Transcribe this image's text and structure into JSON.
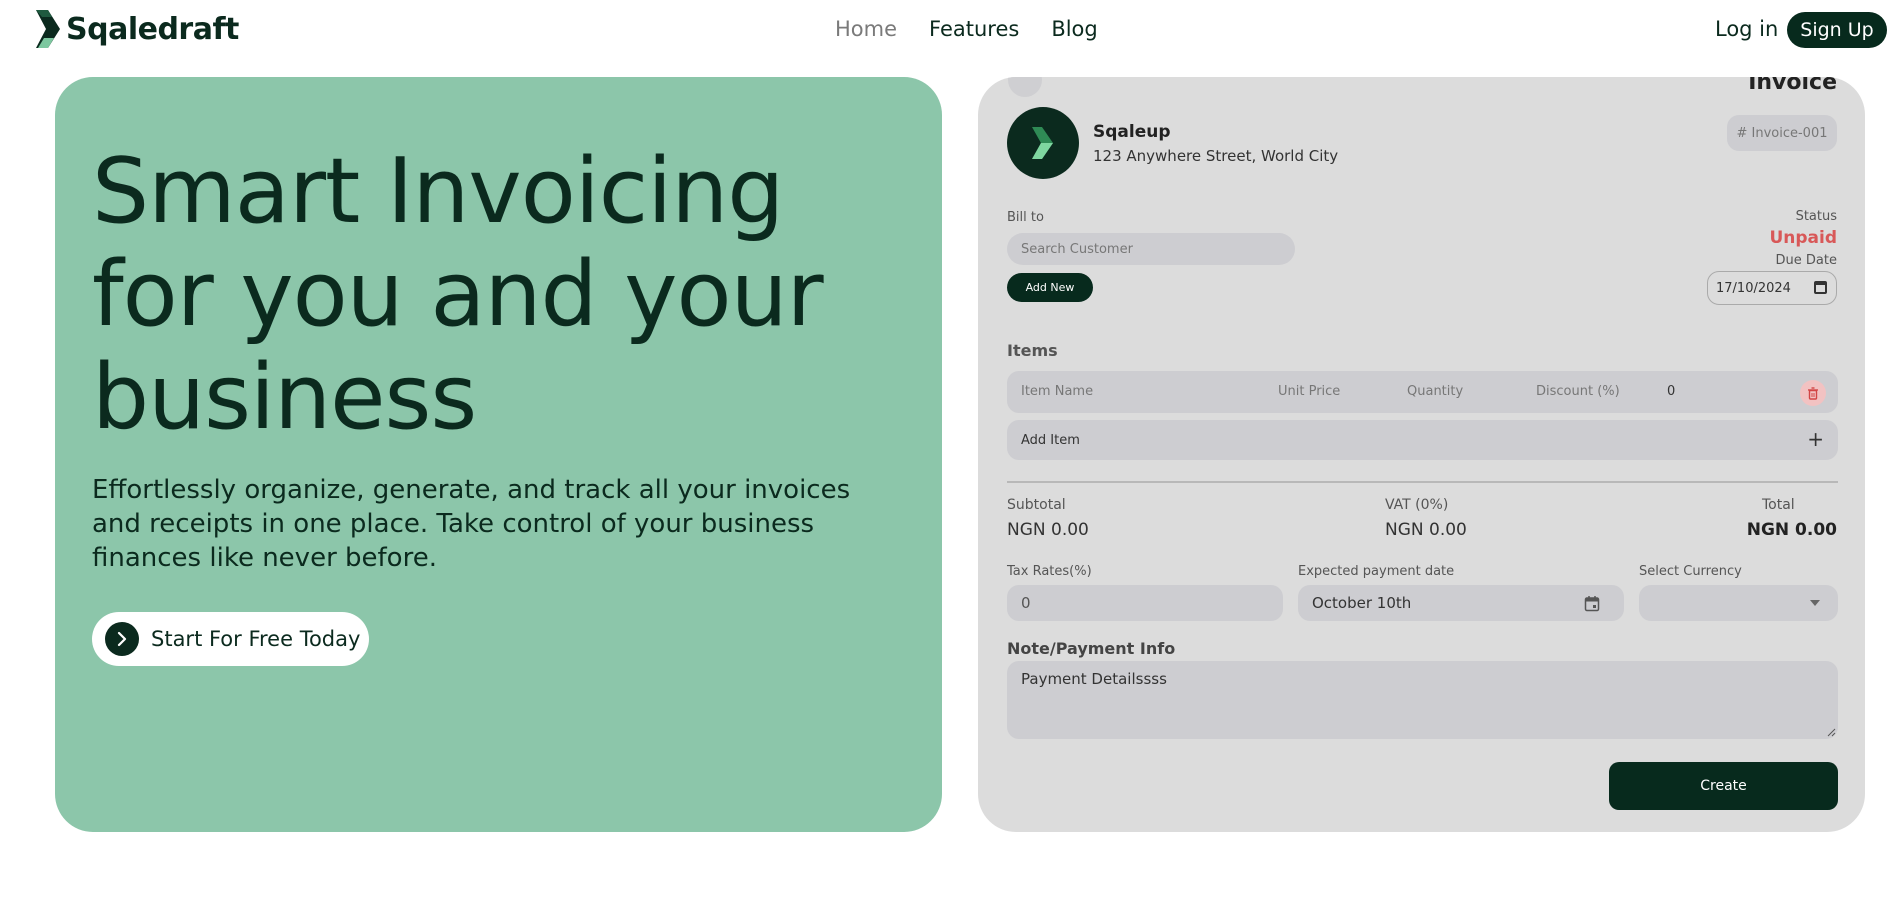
{
  "nav": {
    "brand": "Sqaledraft",
    "links": [
      "Home",
      "Features",
      "Blog"
    ],
    "login": "Log in",
    "signup": "Sign Up"
  },
  "hero": {
    "title": "Smart Invoicing for you and your business",
    "description": "Effortlessly organize, generate, and track all your invoices and receipts in one place. Take control of your business finances like never before.",
    "cta": "Start For Free Today"
  },
  "invoice": {
    "title": "Invoice",
    "company_name": "Sqaleup",
    "company_address": "123 Anywhere Street, World City",
    "invoice_number": "# Invoice-001",
    "bill_to_label": "Bill to",
    "search_placeholder": "Search Customer",
    "add_new": "Add New",
    "status_label": "Status",
    "status_value": "Unpaid",
    "due_date_label": "Due Date",
    "due_date_value": "17/10/2024",
    "items_heading": "Items",
    "item_columns": {
      "name": "Item Name",
      "unit_price": "Unit Price",
      "quantity": "Quantity",
      "discount": "Discount (%)",
      "amount": "0"
    },
    "add_item": "Add Item",
    "subtotal_label": "Subtotal",
    "subtotal_value": "NGN 0.00",
    "vat_label": "VAT (0%)",
    "vat_value": "NGN 0.00",
    "total_label": "Total",
    "total_value": "NGN 0.00",
    "tax_label": "Tax Rates(%)",
    "tax_value": "0",
    "payment_date_label": "Expected payment date",
    "payment_date_value": "October 10th",
    "currency_label": "Select Currency",
    "currency_value": "",
    "note_heading": "Note/Payment Info",
    "note_value": "Payment Detailssss",
    "create": "Create"
  },
  "colors": {
    "brand_dark": "#072a1d",
    "hero_green": "#8cc6aa",
    "panel_grey": "#dcdcdc",
    "status_red": "#d85858"
  }
}
